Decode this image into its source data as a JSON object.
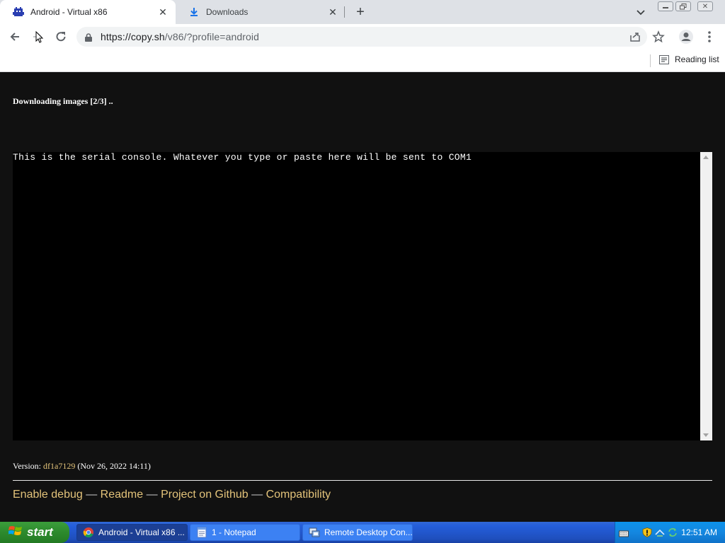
{
  "browser": {
    "tabs": [
      {
        "title": "Android - Virtual x86",
        "active": true
      },
      {
        "title": "Downloads",
        "active": false
      }
    ],
    "url": {
      "host": "https://copy.sh",
      "path": "/v86/?profile=android"
    },
    "reading_list": "Reading list"
  },
  "page": {
    "status": "Downloading images [2/3] ..",
    "console_text": "This is the serial console. Whatever you type or paste here will be sent to COM1",
    "version_label": "Version:",
    "version_hash": "df1a7129",
    "version_date": "(Nov 26, 2022 14:11)",
    "links": [
      "Enable debug",
      "Readme",
      "Project on Github",
      "Compatibility"
    ],
    "link_separator": "—"
  },
  "taskbar": {
    "start_label": "start",
    "tasks": [
      {
        "label": "Android - Virtual x86 ...",
        "icon": "chrome-icon",
        "active": true
      },
      {
        "label": "1 - Notepad",
        "icon": "notepad-icon",
        "active": false
      },
      {
        "label": "Remote Desktop Con...",
        "icon": "remote-desktop-icon",
        "active": false
      }
    ],
    "clock": "12:51 AM"
  }
}
